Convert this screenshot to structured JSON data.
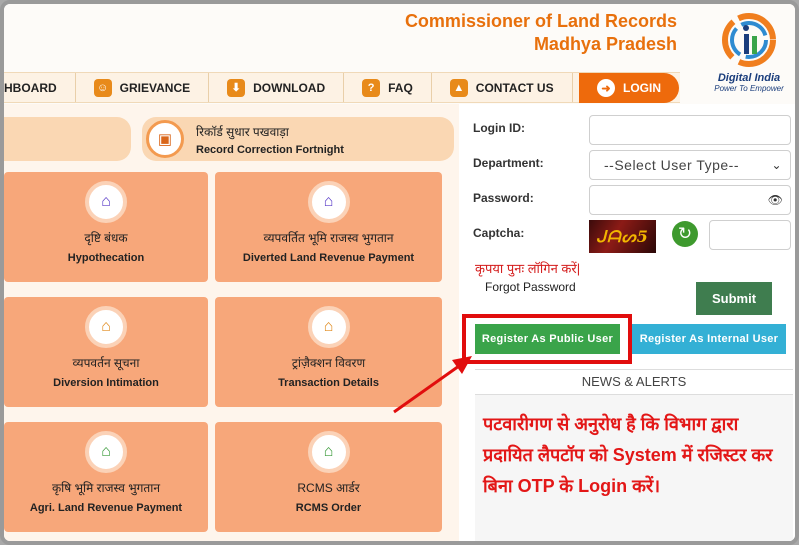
{
  "header": {
    "title_line1": "Commissioner of Land Records",
    "title_line2": "Madhya Pradesh",
    "logo_name": "Digital India",
    "logo_tagline": "Power To Empower"
  },
  "nav": {
    "items": [
      {
        "label": "HBOARD",
        "icon": ""
      },
      {
        "label": "GRIEVANCE",
        "icon": "grievance-icon"
      },
      {
        "label": "DOWNLOAD",
        "icon": "download-icon"
      },
      {
        "label": "FAQ",
        "icon": "faq-icon"
      },
      {
        "label": "CONTACT US",
        "icon": "contact-icon"
      }
    ],
    "login_label": "LOGIN"
  },
  "banner": {
    "hi": "रिकॉर्ड सुधार पखवाड़ा",
    "en": "Record Correction Fortnight"
  },
  "cards": [
    {
      "hi": "दृष्टि बंधक",
      "en": "Hypothecation",
      "icon": "home-icon",
      "color": "#5a3cc8"
    },
    {
      "hi": "व्यपवर्तित भूमि राजस्व भुगतान",
      "en": "Diverted Land Revenue Payment",
      "icon": "home-icon",
      "color": "#5a3cc8"
    },
    {
      "hi": "व्यपवर्तन सूचना",
      "en": "Diversion Intimation",
      "icon": "home-icon",
      "color": "#e08a1c"
    },
    {
      "hi": "ट्रांज़ैक्शन विवरण",
      "en": "Transaction Details",
      "icon": "home-icon",
      "color": "#e08a1c"
    },
    {
      "hi": "कृषि भूमि राजस्व भुगतान",
      "en": "Agri. Land Revenue Payment",
      "icon": "home-icon",
      "color": "#3a9a3a"
    },
    {
      "hi": "RCMS आर्डर",
      "en": "RCMS Order",
      "icon": "home-icon",
      "color": "#3a9a3a"
    }
  ],
  "login": {
    "login_id_label": "Login ID:",
    "department_label": "Department:",
    "department_value": "--Select User Type--",
    "password_label": "Password:",
    "captcha_label": "Captcha:",
    "captcha_text": "ᒍᗩᔕ5",
    "error_text": "कृपया पुनः लॉगिन करें|",
    "forgot_password": "Forgot Password",
    "submit": "Submit",
    "register_public": "Register As Public User",
    "register_internal": "Register As Internal User"
  },
  "news": {
    "heading": "NEWS & ALERTS",
    "text": "पटवारीगण से अनुरोध है कि विभाग द्वारा प्रदायित लैपटॉप को System में रजिस्टर कर बिना OTP के Login करें।"
  }
}
